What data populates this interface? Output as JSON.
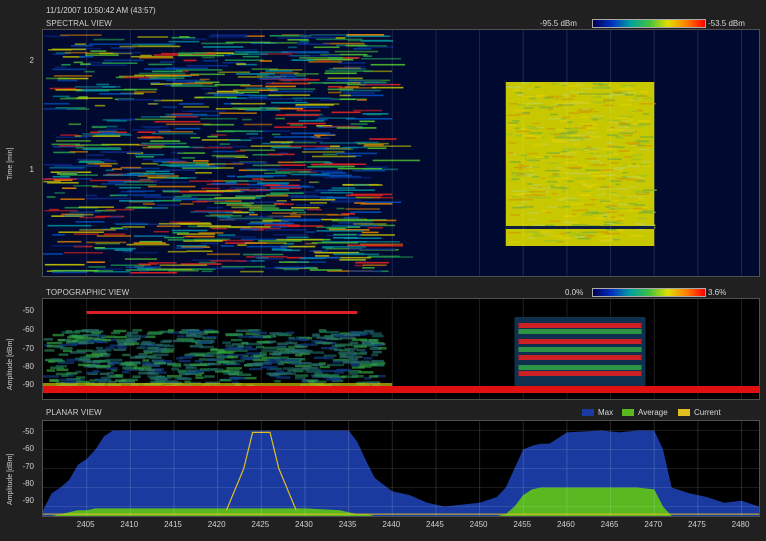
{
  "header": {
    "timestamp": "11/1/2007 10:50:42 AM (43:57)"
  },
  "spectral": {
    "title": "SPECTRAL VIEW",
    "legend_min": "-95.5 dBm",
    "legend_max": "-53.5 dBm",
    "ylabel": "Time [min]",
    "yticks": [
      "2",
      "1"
    ]
  },
  "topographic": {
    "title": "TOPOGRAPHIC VIEW",
    "legend_min": "0.0%",
    "legend_max": "3.6%",
    "ylabel": "Amplitude [dBm]",
    "yticks": [
      "-50",
      "-60",
      "-70",
      "-80",
      "-90"
    ]
  },
  "planar": {
    "title": "PLANAR VIEW",
    "ylabel": "Amplitude [dBm]",
    "yticks": [
      "-50",
      "-60",
      "-70",
      "-80",
      "-90"
    ],
    "legend": [
      {
        "name": "Max",
        "color": "#1a3aa0"
      },
      {
        "name": "Average",
        "color": "#5ab820"
      },
      {
        "name": "Current",
        "color": "#e0c020"
      }
    ]
  },
  "xaxis": {
    "ticks": [
      "2405",
      "2410",
      "2415",
      "2420",
      "2425",
      "2430",
      "2435",
      "2440",
      "2445",
      "2450",
      "2455",
      "2460",
      "2465",
      "2470",
      "2475",
      "2480"
    ]
  },
  "chart_data": {
    "type": "area",
    "x": [
      2400,
      2401,
      2402,
      2403,
      2404,
      2405,
      2406,
      2407,
      2408,
      2409,
      2410,
      2420,
      2430,
      2434,
      2435,
      2436,
      2437,
      2438,
      2440,
      2442,
      2444,
      2446,
      2448,
      2450,
      2452,
      2453,
      2454,
      2455,
      2456,
      2457,
      2458,
      2460,
      2464,
      2466,
      2468,
      2470,
      2471,
      2472,
      2474,
      2476,
      2478,
      2480,
      2482
    ],
    "series": [
      {
        "name": "Max",
        "values": [
          -92,
          -83,
          -80,
          -76,
          -68,
          -65,
          -60,
          -53,
          -50,
          -50,
          -50,
          -50,
          -50,
          -50,
          -50,
          -56,
          -66,
          -75,
          -82,
          -84,
          -88,
          -90,
          -89,
          -88,
          -85,
          -80,
          -70,
          -60,
          -58,
          -57,
          -57,
          -51,
          -50,
          -51,
          -50,
          -50,
          -60,
          -80,
          -83,
          -85,
          -88,
          -87,
          -90
        ]
      },
      {
        "name": "Average",
        "values": [
          -96,
          -95,
          -94,
          -93,
          -92,
          -92,
          -91,
          -91,
          -91,
          -91,
          -91,
          -91,
          -91,
          -92,
          -93,
          -94,
          -94,
          -95,
          -95,
          -95,
          -95,
          -95,
          -95,
          -95,
          -95,
          -94,
          -90,
          -84,
          -81,
          -80,
          -80,
          -80,
          -80,
          -80,
          -80,
          -81,
          -90,
          -95,
          -95,
          -95,
          -95,
          -95,
          -95
        ]
      }
    ],
    "current_peak": {
      "name": "Current",
      "x": [
        2421,
        2423,
        2424,
        2426,
        2427,
        2429
      ],
      "values": [
        -92,
        -70,
        -51,
        -51,
        -70,
        -92
      ]
    },
    "xlim": [
      2400,
      2482
    ],
    "ylim": [
      -95,
      -45
    ]
  }
}
